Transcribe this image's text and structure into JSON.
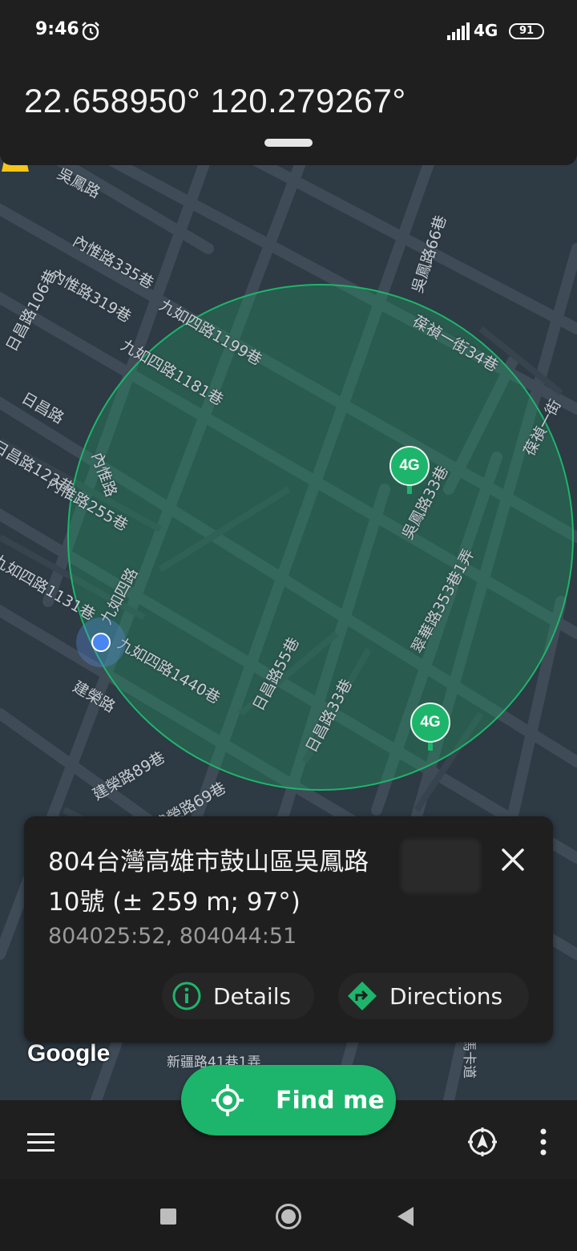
{
  "status_bar": {
    "time": "9:46",
    "network": "4G",
    "battery": "91",
    "icons": [
      "alarm-icon",
      "signal-icon",
      "battery-icon"
    ]
  },
  "coordinates": {
    "text": "22.658950° 120.279267°"
  },
  "map": {
    "labels": {
      "l1": "吳鳳路",
      "l2": "內惟路335巷",
      "l3": "內惟路319巷",
      "l4": "九如四路1199巷",
      "l5": "九如四路1181巷",
      "l6": "日昌路106巷",
      "l7": "日昌路",
      "l8": "日昌路123巷",
      "l9": "內惟路",
      "l10": "內惟路255巷",
      "l11": "九如四路1131巷",
      "l12": "九如四路",
      "l13": "九如四路1440巷",
      "l14": "建榮路",
      "l15": "建榮路89巷",
      "l16": "建榮路69巷",
      "l17": "日昌路55巷",
      "l18": "日昌路33巷",
      "l19": "吳鳳路66巷",
      "l20": "葆禎一街34巷",
      "l21": "葆禎一街",
      "l22": "吳鳳路33巷",
      "l23": "翠華路353巷1弄",
      "l24": "新疆路41巷1弄",
      "l25": "馬卡道"
    },
    "markers": [
      {
        "label": "4G",
        "primary": true
      },
      {
        "label": "4G",
        "primary": false
      }
    ],
    "attribution": "Google",
    "accuracy_color": "#1db56b"
  },
  "info_card": {
    "address_line1": "804台灣高雄市鼓山區吳鳳路",
    "address_line2": "10號 (± 259 m; 97°)",
    "cells": "804025:52, 804044:51",
    "details_label": "Details",
    "directions_label": "Directions"
  },
  "find_me": {
    "label": "Find me"
  },
  "bottom_bar": {
    "icons": [
      "menu-icon",
      "compass-icon",
      "more-vert-icon"
    ]
  },
  "nav_bar": {
    "icons": [
      "recents-icon",
      "home-icon",
      "back-icon"
    ]
  }
}
